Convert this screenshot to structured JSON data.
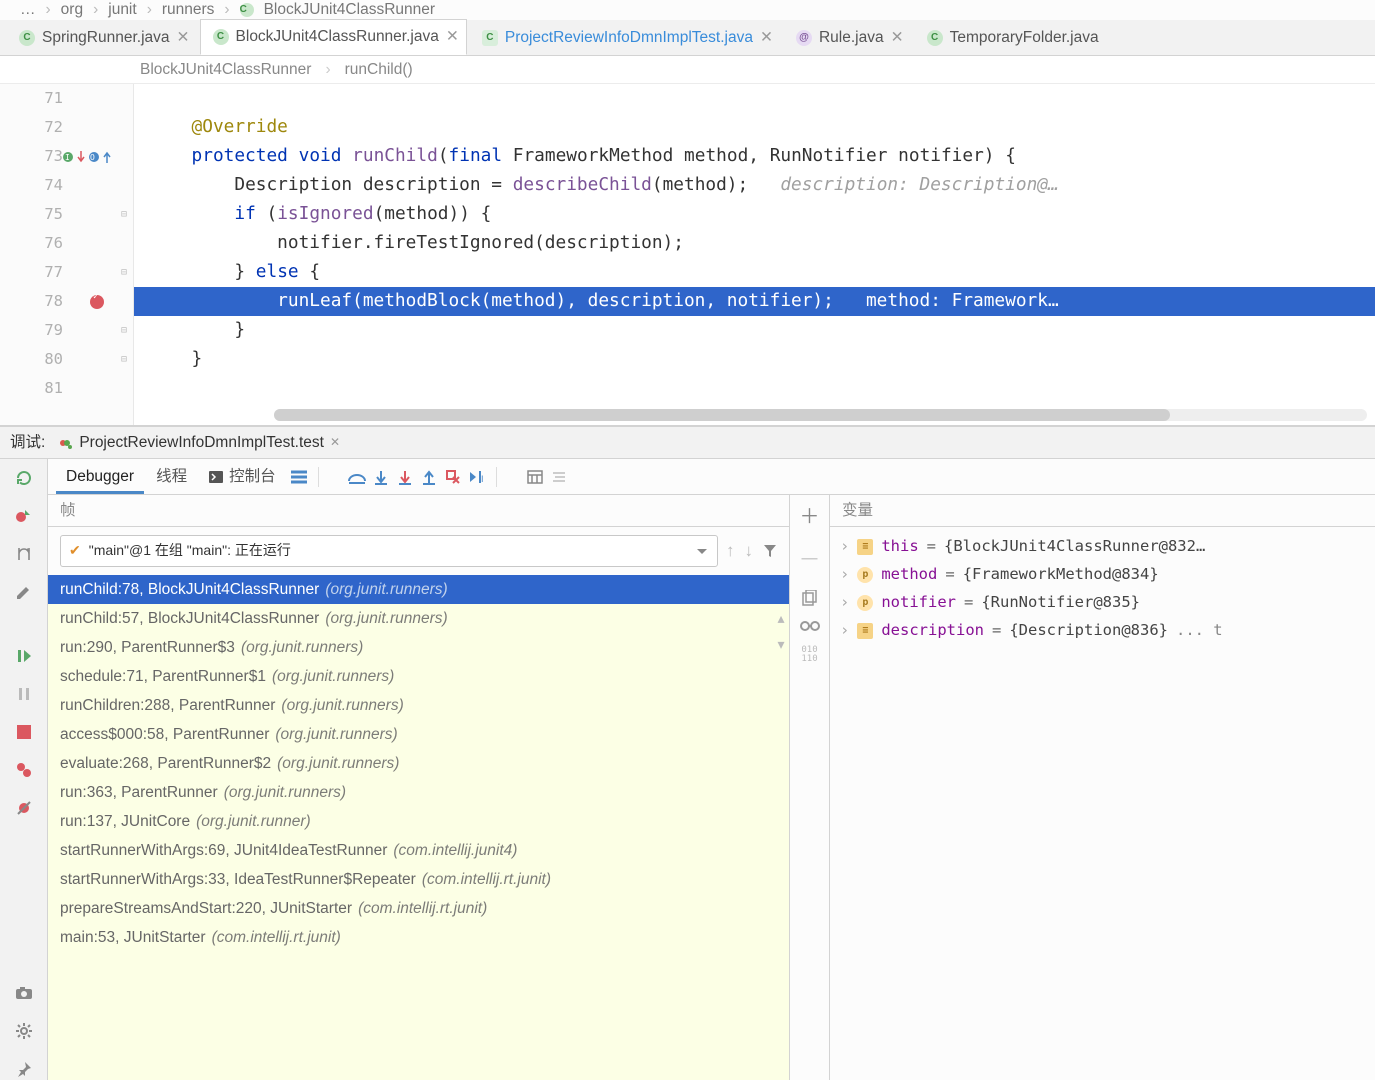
{
  "top_crumb": {
    "parts": [
      "...",
      "org",
      "junit",
      "runners",
      "BlockJUnit4ClassRunner"
    ]
  },
  "tabs": [
    {
      "label": "SpringRunner.java",
      "icon": "class",
      "closable": true,
      "active": false,
      "link": false
    },
    {
      "label": "BlockJUnit4ClassRunner.java",
      "icon": "class",
      "closable": true,
      "active": true,
      "link": false
    },
    {
      "label": "ProjectReviewInfoDmnImplTest.java",
      "icon": "test",
      "closable": true,
      "active": false,
      "link": true
    },
    {
      "label": "Rule.java",
      "icon": "anno",
      "closable": true,
      "active": false,
      "link": false
    },
    {
      "label": "TemporaryFolder.java",
      "icon": "class",
      "closable": false,
      "active": false,
      "link": false
    }
  ],
  "crumb": {
    "class": "BlockJUnit4ClassRunner",
    "method": "runChild()"
  },
  "code": {
    "first_line": 71,
    "lines": [
      {
        "n": 71,
        "segs": []
      },
      {
        "n": 72,
        "segs": [
          {
            "cls": "tok-anno",
            "indent": 5,
            "t": "@Override"
          }
        ]
      },
      {
        "n": 73,
        "marks": "io",
        "segs": [
          {
            "cls": "tok-kw",
            "indent": 5,
            "t": "protected"
          },
          {
            "cls": "",
            "t": " "
          },
          {
            "cls": "tok-kw",
            "t": "void"
          },
          {
            "cls": "",
            "t": " "
          },
          {
            "cls": "tok-mtd",
            "t": "runChild"
          },
          {
            "cls": "",
            "t": "("
          },
          {
            "cls": "tok-kw",
            "t": "final"
          },
          {
            "cls": "",
            "t": " FrameworkMethod method, RunNotifier notifier) {"
          }
        ]
      },
      {
        "n": 74,
        "segs": [
          {
            "cls": "",
            "indent": 9,
            "t": "Description description = "
          },
          {
            "cls": "tok-mtd",
            "t": "describeChild"
          },
          {
            "cls": "",
            "t": "(method);   "
          },
          {
            "cls": "tok-hint",
            "t": "description: Description@…"
          }
        ]
      },
      {
        "n": 75,
        "fold": "open",
        "segs": [
          {
            "cls": "tok-kw",
            "indent": 9,
            "t": "if"
          },
          {
            "cls": "",
            "t": " ("
          },
          {
            "cls": "tok-mtd",
            "t": "isIgnored"
          },
          {
            "cls": "",
            "t": "(method)) {"
          }
        ]
      },
      {
        "n": 76,
        "segs": [
          {
            "cls": "",
            "indent": 13,
            "t": "notifier.fireTestIgnored(description);"
          }
        ]
      },
      {
        "n": 77,
        "fold": "close",
        "segs": [
          {
            "cls": "",
            "indent": 9,
            "t": "} "
          },
          {
            "cls": "tok-kw",
            "t": "else"
          },
          {
            "cls": "",
            "t": " {"
          }
        ]
      },
      {
        "n": 78,
        "bp": true,
        "selected": true,
        "segs": [
          {
            "cls": "",
            "indent": 13,
            "t": "runLeaf(methodBlock(method), description, notifier);   "
          },
          {
            "cls": "tok-hint",
            "t": "method: Framework…"
          }
        ]
      },
      {
        "n": 79,
        "fold": "close",
        "segs": [
          {
            "cls": "",
            "indent": 9,
            "t": "}"
          }
        ]
      },
      {
        "n": 80,
        "fold": "close",
        "segs": [
          {
            "cls": "",
            "indent": 5,
            "t": "}"
          }
        ]
      },
      {
        "n": 81,
        "segs": []
      }
    ]
  },
  "debug": {
    "panel_label": "调试:",
    "session": "ProjectReviewInfoDmnImplTest.test",
    "debugger_tab": "Debugger",
    "threads_tab": "线程",
    "console_tab": "控制台",
    "frames_header": "帧",
    "thread_text": "\"main\"@1 在组 \"main\": 正在运行",
    "frames": [
      {
        "label": "runChild:78, BlockJUnit4ClassRunner",
        "pkg": "(org.junit.runners)",
        "active": true
      },
      {
        "label": "runChild:57, BlockJUnit4ClassRunner",
        "pkg": "(org.junit.runners)"
      },
      {
        "label": "run:290, ParentRunner$3",
        "pkg": "(org.junit.runners)"
      },
      {
        "label": "schedule:71, ParentRunner$1",
        "pkg": "(org.junit.runners)"
      },
      {
        "label": "runChildren:288, ParentRunner",
        "pkg": "(org.junit.runners)"
      },
      {
        "label": "access$000:58, ParentRunner",
        "pkg": "(org.junit.runners)"
      },
      {
        "label": "evaluate:268, ParentRunner$2",
        "pkg": "(org.junit.runners)"
      },
      {
        "label": "run:363, ParentRunner",
        "pkg": "(org.junit.runners)"
      },
      {
        "label": "run:137, JUnitCore",
        "pkg": "(org.junit.runner)"
      },
      {
        "label": "startRunnerWithArgs:69, JUnit4IdeaTestRunner",
        "pkg": "(com.intellij.junit4)"
      },
      {
        "label": "startRunnerWithArgs:33, IdeaTestRunner$Repeater",
        "pkg": "(com.intellij.rt.junit)"
      },
      {
        "label": "prepareStreamsAndStart:220, JUnitStarter",
        "pkg": "(com.intellij.rt.junit)"
      },
      {
        "label": "main:53, JUnitStarter",
        "pkg": "(com.intellij.rt.junit)"
      }
    ],
    "vars_header": "变量",
    "vars": [
      {
        "name": "this",
        "val": "{BlockJUnit4ClassRunner@832…",
        "kind": "f"
      },
      {
        "name": "method",
        "val": "{FrameworkMethod@834}",
        "kind": "p"
      },
      {
        "name": "notifier",
        "val": "{RunNotifier@835}",
        "kind": "p"
      },
      {
        "name": "description",
        "val": "{Description@836}",
        "kind": "f",
        "trunc": "... t"
      }
    ]
  }
}
